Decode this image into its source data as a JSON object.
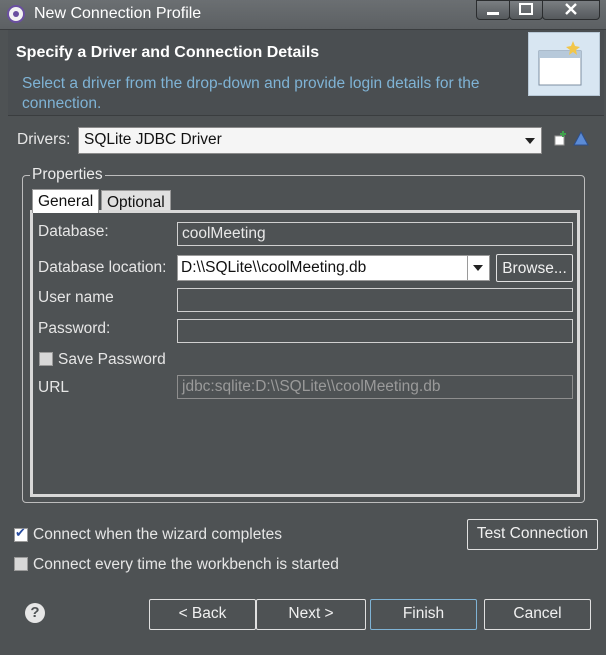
{
  "window": {
    "title": "New Connection Profile"
  },
  "header": {
    "title": "Specify a Driver and Connection Details",
    "description": "Select a driver from the drop-down and provide login details for the connection."
  },
  "drivers": {
    "label": "Drivers:",
    "selected": "SQLite JDBC Driver"
  },
  "properties": {
    "group_title": "Properties",
    "tabs": [
      {
        "label": "General",
        "active": true
      },
      {
        "label": "Optional",
        "active": false
      }
    ],
    "general": {
      "database_label": "Database:",
      "database_value": "coolMeeting",
      "database_location_label": "Database location:",
      "database_location_value": "D:\\\\SQLite\\\\coolMeeting.db",
      "browse_label": "Browse...",
      "user_name_label": "User name",
      "user_name_value": "",
      "password_label": "Password:",
      "password_value": "",
      "save_password_label": "Save Password",
      "save_password_checked": false,
      "url_label": "URL",
      "url_value": "jdbc:sqlite:D:\\\\SQLite\\\\coolMeeting.db"
    }
  },
  "options": {
    "connect_when_completes": {
      "label": "Connect when the wizard completes",
      "checked": true
    },
    "connect_every_time": {
      "label": "Connect every time the workbench is started",
      "checked": false
    },
    "test_connection_label": "Test Connection"
  },
  "footer": {
    "help_icon": "?",
    "back_label": "< Back",
    "next_label": "Next >",
    "finish_label": "Finish",
    "cancel_label": "Cancel"
  },
  "icons": {
    "app": "connection-profile-icon",
    "new_driver": "new-driver-icon",
    "edit_driver": "edit-driver-icon",
    "header_image": "wizard-banner-icon"
  }
}
